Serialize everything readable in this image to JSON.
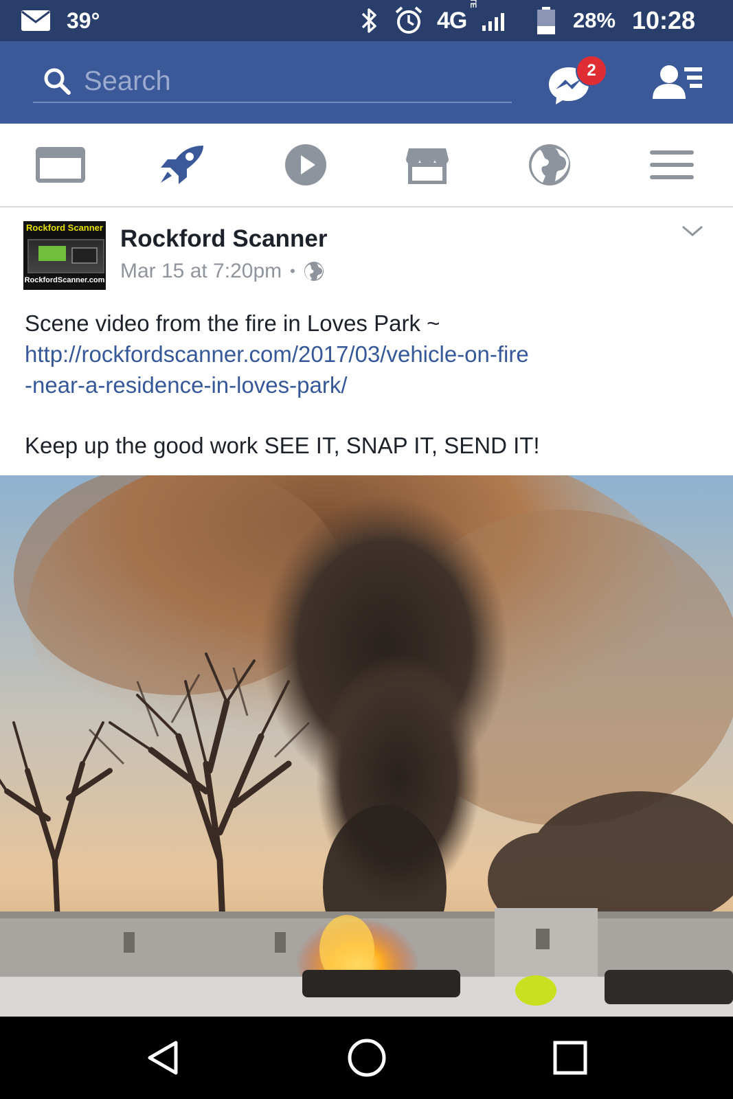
{
  "status_bar": {
    "temperature": "39°",
    "network": "4G",
    "network_sub": "LTE",
    "battery": "28%",
    "time": "10:28"
  },
  "header": {
    "search_placeholder": "Search",
    "messenger_badge": "2"
  },
  "tabs": [
    {
      "icon": "news-feed-icon",
      "active": false
    },
    {
      "icon": "rocket-icon",
      "active": true
    },
    {
      "icon": "video-icon",
      "active": false
    },
    {
      "icon": "marketplace-icon",
      "active": false
    },
    {
      "icon": "globe-icon",
      "active": false
    },
    {
      "icon": "menu-icon",
      "active": false
    }
  ],
  "post": {
    "page_name": "Rockford Scanner",
    "timestamp": "Mar 15 at 7:20pm",
    "separator": "•",
    "avatar_text_top": "Rockford Scanner",
    "avatar_text_bottom": "RockfordScanner.com",
    "text_line1": "Scene video from the fire in Loves Park  ~",
    "link_line1": "http://rockfordscanner.com/2017/03/vehicle-on-fire",
    "link_line2": "-near-a-residence-in-loves-park/",
    "text_line2": "Keep up the good work SEE IT, SNAP IT, SEND IT!"
  },
  "colors": {
    "brand_blue": "#3b5998",
    "status_bar": "#2a3e6b",
    "link": "#365899",
    "badge_red": "#e02d33"
  }
}
